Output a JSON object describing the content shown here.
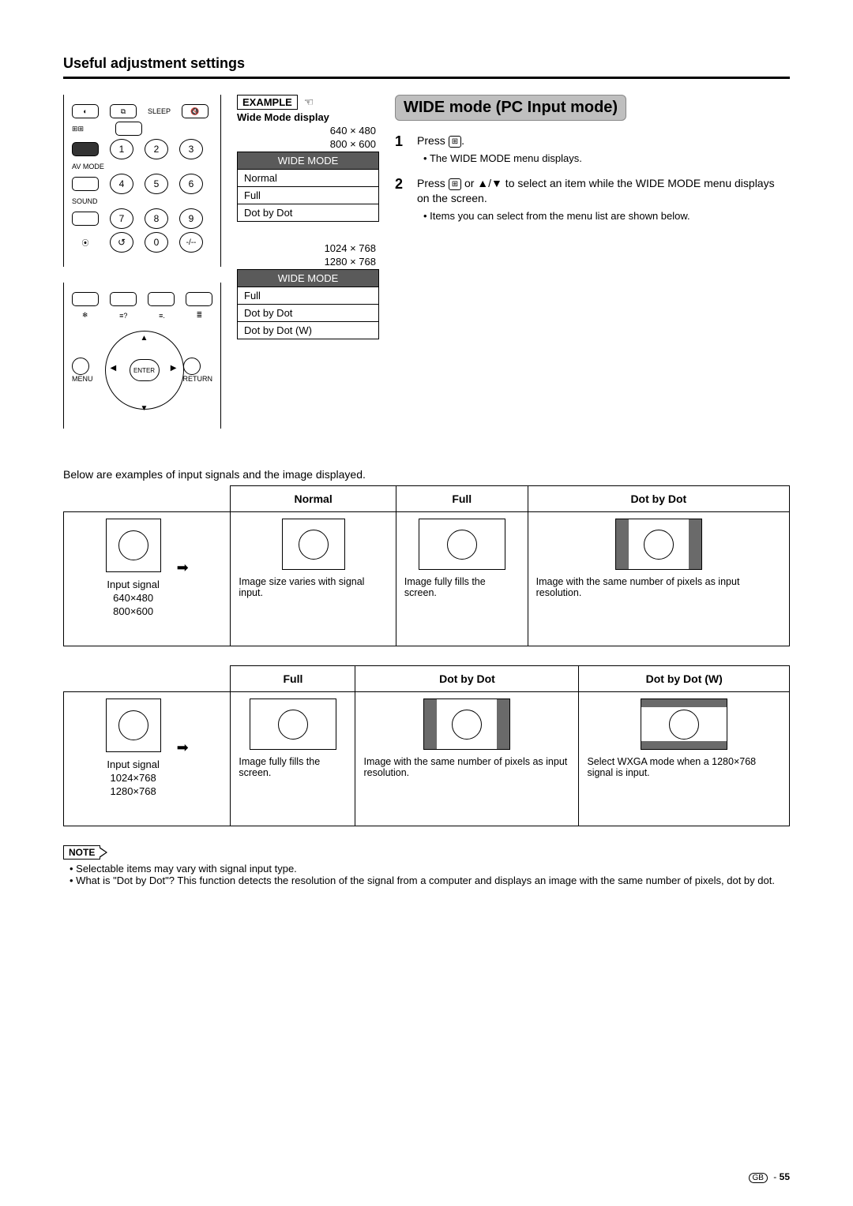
{
  "page_title": "Useful adjustment settings",
  "example_label": "EXAMPLE",
  "example_heading": "Wide Mode display",
  "res_group_a": [
    "640  ×  480",
    "800  ×  600"
  ],
  "res_group_b": [
    "1024  ×  768",
    "1280  ×  768"
  ],
  "osd_header": "WIDE MODE",
  "osd_a_items": [
    "Normal",
    "Full",
    "Dot by Dot"
  ],
  "osd_b_items": [
    "Full",
    "Dot by Dot",
    "Dot by Dot (W)"
  ],
  "section_banner": "WIDE mode (PC Input mode)",
  "steps": {
    "s1": {
      "num": "1",
      "line": "Press ",
      "bullet": "The WIDE MODE menu displays."
    },
    "s2": {
      "num": "2",
      "line_a": "Press ",
      "line_b": " or ▲/▼ to select an item while the WIDE MODE menu displays on the screen.",
      "bullet": "Items you can select from the menu list are shown below."
    }
  },
  "intro_line": "Below are examples of input signals and the image displayed.",
  "table1": {
    "headers": [
      "Normal",
      "Full",
      "Dot by Dot"
    ],
    "input": {
      "title": "Input signal",
      "res": [
        "640×480",
        "800×600"
      ]
    },
    "c1": "Image size varies with signal input.",
    "c2": "Image fully fills the screen.",
    "c3": "Image with the same number of pixels as input resolution."
  },
  "table2": {
    "headers": [
      "Full",
      "Dot by Dot",
      "Dot by Dot (W)"
    ],
    "input": {
      "title": "Input signal",
      "res": [
        "1024×768",
        "1280×768"
      ]
    },
    "c1": "Image fully fills the screen.",
    "c2": "Image with the same number of pixels as input resolution.",
    "c3": "Select WXGA mode when a 1280×768 signal is input."
  },
  "note_label": "NOTE",
  "notes": [
    "Selectable items may vary with signal input type.",
    "What is \"Dot by Dot\"? This function detects the resolution of  the signal from a computer and displays an image with the same number of pixels, dot by dot."
  ],
  "remote": {
    "sleep": "SLEEP",
    "av_mode": "AV MODE",
    "sound": "SOUND",
    "enter": "ENTER",
    "menu": "MENU",
    "return": "RETURN",
    "digits": [
      "1",
      "2",
      "3",
      "4",
      "5",
      "6",
      "7",
      "8",
      "9",
      "0"
    ]
  },
  "footer": {
    "region": "GB",
    "page": "55"
  }
}
